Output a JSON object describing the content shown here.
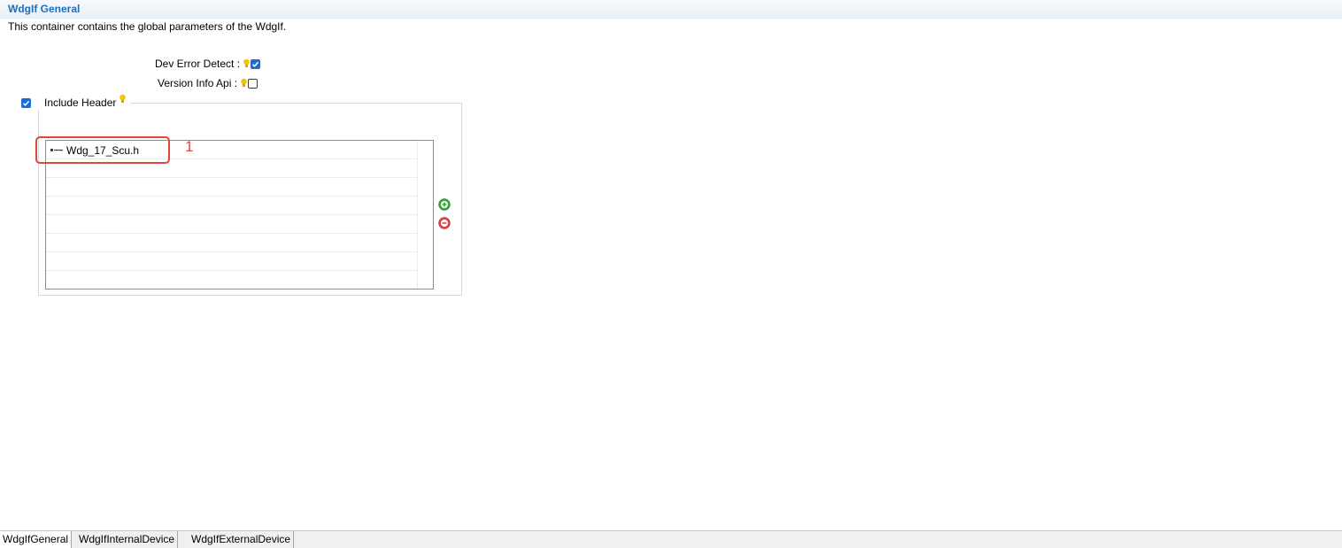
{
  "header": {
    "title": "WdgIf General",
    "description": "This container contains the global parameters of the WdgIf."
  },
  "params": {
    "dev_error_detect": {
      "label": "Dev Error Detect :",
      "checked": true
    },
    "version_info_api": {
      "label": "Version Info Api :",
      "checked": false
    }
  },
  "include_header": {
    "label": "Include Header",
    "checked": true,
    "entries": [
      "Wdg_17_Scu.h"
    ],
    "add_icon": "add-icon",
    "remove_icon": "remove-icon"
  },
  "annotation": {
    "number": "1"
  },
  "tabs": [
    {
      "label": "WdgIfGeneral",
      "active": true
    },
    {
      "label": "WdgIfInternalDevice",
      "active": false
    },
    {
      "label": "WdgIfExternalDevice",
      "active": false
    }
  ],
  "colors": {
    "title_blue": "#1a6fc0",
    "checkbox_blue": "#1e6ad6",
    "annotation_red": "#e0463c",
    "add_green": "#3eaa3e",
    "remove_red": "#e04848"
  }
}
